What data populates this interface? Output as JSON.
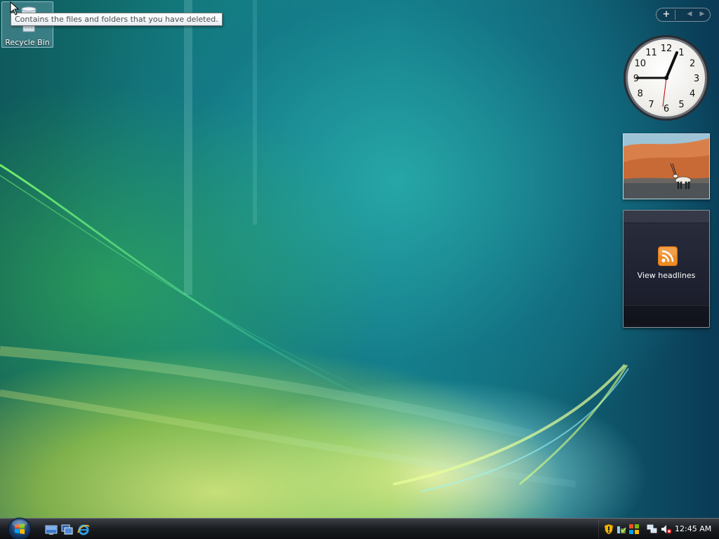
{
  "desktop": {
    "icons": [
      {
        "label": "Recycle Bin",
        "icon": "recycle-bin-icon"
      }
    ],
    "tooltip": "Contains the files and folders that you have deleted."
  },
  "sidebar": {
    "controls": {
      "add_label": "+",
      "prev_label": "◀",
      "next_label": "▶"
    },
    "gadgets": {
      "clock": {
        "numerals": [
          "12",
          "1",
          "2",
          "3",
          "4",
          "5",
          "6",
          "7",
          "8",
          "9",
          "10",
          "11"
        ]
      },
      "slideshow": {
        "icon": "oryx-desert-photo"
      },
      "feeds": {
        "label": "View headlines",
        "icon": "rss-feed-icon"
      }
    }
  },
  "taskbar": {
    "start_icon": "windows-start-orb",
    "quick_launch": [
      {
        "name": "show-desktop-icon"
      },
      {
        "name": "switch-windows-icon"
      },
      {
        "name": "internet-explorer-icon"
      }
    ],
    "tray": {
      "icons": [
        "windows-security-alert-icon",
        "network-safely-remove-icon",
        "windows-update-icon",
        "network-connection-icon",
        "volume-muted-icon"
      ],
      "time": "12:45 AM"
    }
  },
  "colors": {
    "taskbar_top": "#3c4046",
    "taskbar_bottom": "#0c0e10",
    "feed_orange": "#f08a24",
    "tooltip_border": "#767676"
  }
}
